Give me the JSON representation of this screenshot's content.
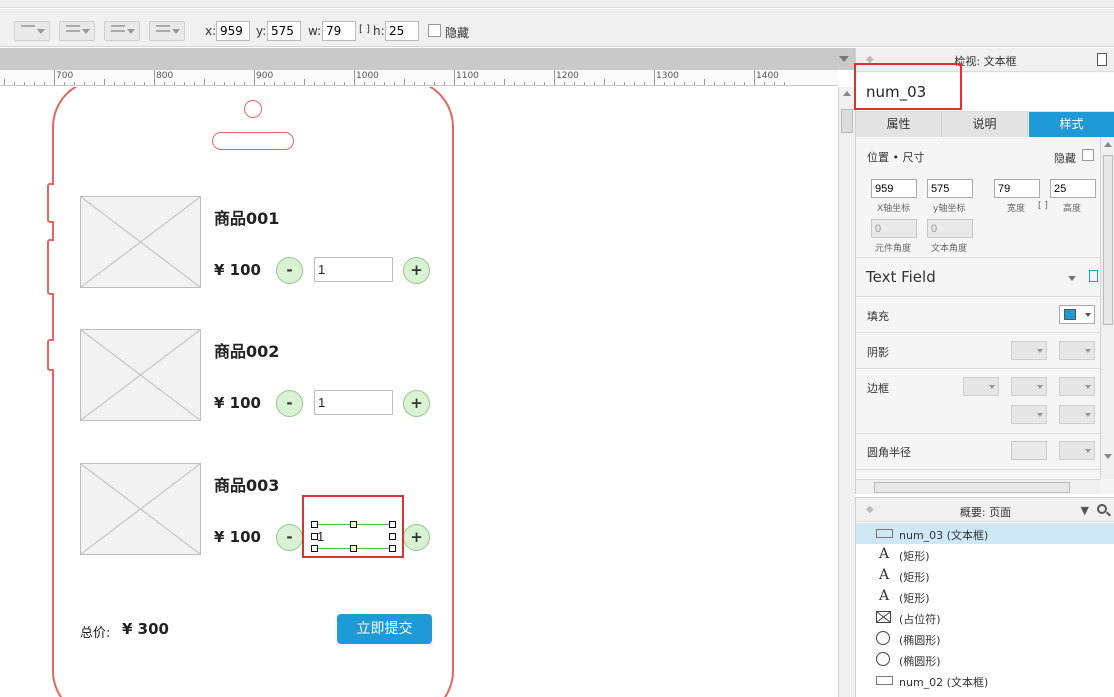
{
  "toolbar": {
    "x_label": "x:",
    "x_value": "959",
    "y_label": "y:",
    "y_value": "575",
    "w_label": "w:",
    "w_value": "79",
    "h_label": "h:",
    "h_value": "25",
    "hidden_label": "隐藏"
  },
  "ruler": {
    "labels": [
      "700",
      "800",
      "900",
      "1000",
      "1100",
      "1200",
      "1300",
      "1400"
    ]
  },
  "products": [
    {
      "name": "商品001",
      "price": "¥ 100",
      "qty": "1"
    },
    {
      "name": "商品002",
      "price": "¥ 100",
      "qty": "1"
    },
    {
      "name": "商品003",
      "price": "¥ 100",
      "qty": "1"
    }
  ],
  "qty_minus": "-",
  "qty_plus": "+",
  "total": {
    "label": "总价:",
    "value": "¥ 300"
  },
  "submit_label": "立即提交",
  "inspector": {
    "title": "检视: 文本框",
    "widget_name": "num_03",
    "tabs": [
      "属性",
      "说明",
      "样式"
    ],
    "position_size_label": "位置 • 尺寸",
    "hidden_label": "隐藏",
    "x": "959",
    "y": "575",
    "w": "79",
    "h": "25",
    "x_caption": "X轴坐标",
    "y_caption": "y轴坐标",
    "w_caption": "宽度",
    "h_caption": "高度",
    "rot1": "0",
    "rot2": "0",
    "rot1_caption": "元件角度",
    "rot2_caption": "文本角度",
    "style_name": "Text Field",
    "fill_label": "填充",
    "shadow_label": "阴影",
    "border_label": "边框",
    "radius_label": "圆角半径",
    "fill_color": "#1e9bd7"
  },
  "outline": {
    "title": "概要: 页面",
    "items": [
      {
        "icon": "textbox",
        "label": "num_03 (文本框)"
      },
      {
        "icon": "A",
        "label": "(矩形)"
      },
      {
        "icon": "A",
        "label": "(矩形)"
      },
      {
        "icon": "A",
        "label": "(矩形)"
      },
      {
        "icon": "placeholder",
        "label": "(占位符)"
      },
      {
        "icon": "circle",
        "label": "(椭圆形)"
      },
      {
        "icon": "circle",
        "label": "(椭圆形)"
      },
      {
        "icon": "textbox",
        "label": "num_02 (文本框)"
      }
    ]
  }
}
